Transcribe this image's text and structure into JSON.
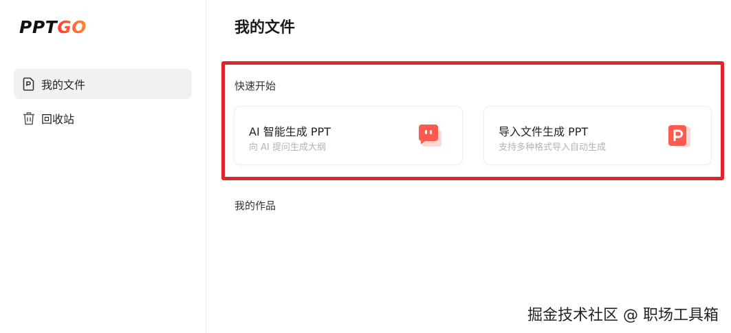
{
  "brand": {
    "logo_part1": "PPT",
    "logo_part2": "GO"
  },
  "sidebar": {
    "items": [
      {
        "label": "我的文件",
        "icon": "file-icon",
        "active": true
      },
      {
        "label": "回收站",
        "icon": "trash-icon",
        "active": false
      }
    ]
  },
  "main": {
    "title": "我的文件",
    "quick_start": {
      "title": "快速开始",
      "cards": [
        {
          "title": "AI 智能生成 PPT",
          "subtitle": "向 AI 提问生成大纲",
          "icon": "chat-bubble-icon"
        },
        {
          "title": "导入文件生成 PPT",
          "subtitle": "支持多种格式导入自动生成",
          "icon": "ppt-file-icon"
        }
      ]
    },
    "works_title": "我的作品"
  },
  "watermark": "掘金技术社区 @ 职场工具箱",
  "colors": {
    "accent": "#ff5a4e",
    "highlight": "#e0242b"
  }
}
